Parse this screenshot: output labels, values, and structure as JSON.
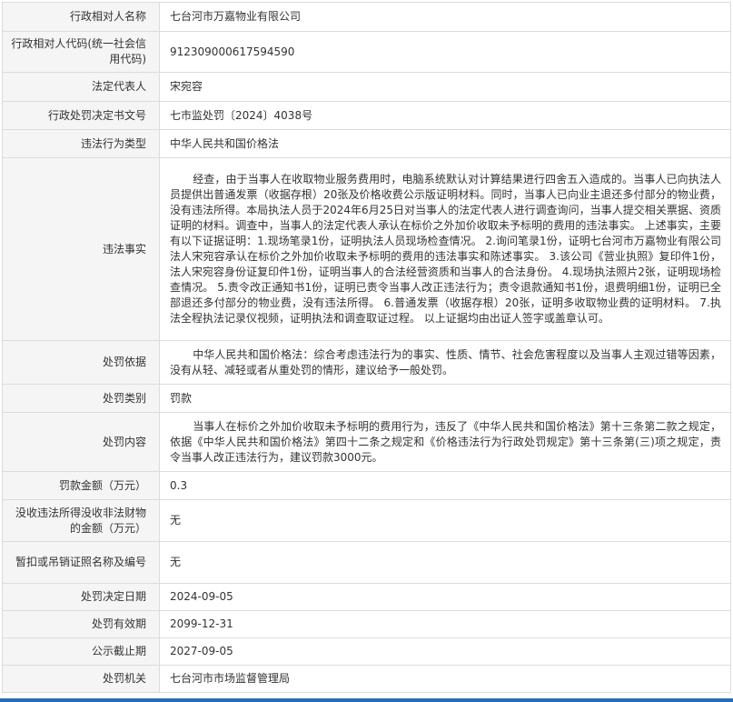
{
  "rows": [
    {
      "label": "行政相对人名称",
      "value": "七台河市万嘉物业有限公司"
    },
    {
      "label": "行政相对人代码(统一社会信用代码)",
      "value": "912309000617594590"
    },
    {
      "label": "法定代表人",
      "value": "宋宛容"
    },
    {
      "label": "行政处罚决定书文号",
      "value": "七市监处罚〔2024〕4038号"
    },
    {
      "label": "违法行为类型",
      "value": "中华人民共和国价格法"
    },
    {
      "label": "违法事实",
      "value": "经查，由于当事人在收取物业服务费用时，电脑系统默认对计算结果进行四舍五入造成的。当事人已向执法人员提供出普通发票（收据存根）20张及价格收费公示版证明材料。同时，当事人已向业主退还多付部分的物业费，没有违法所得。本局执法人员于2024年6月25日对当事人的法定代表人进行调查询问，当事人提交相关票据、资质证明的材料。调查中，当事人的法定代表人承认在标价之外加价收取未予标明的费用的违法事实。 上述事实，主要有以下证据证明：1.现场笔录1份，证明执法人员现场检查情况。 2.询问笔录1份，证明七台河市万嘉物业有限公司法人宋宛容承认在标价之外加价收取未予标明的费用的违法事实和陈述事实。 3.该公司《营业执照》复印件1份，法人宋宛容身份证复印件1份，证明当事人的合法经营资质和当事人的合法身份。 4.现场执法照片2张，证明现场检查情况。 5.责令改正通知书1份，证明已责令当事人改正违法行为；责令退款通知书1份，退费明细1份，证明已全部退还多付部分的物业费，没有违法所得。 6.普通发票（收据存根）20张，证明多收取物业费的证明材料。 7.执法全程执法记录仪视频，证明执法和调查取证过程。 以上证据均由出证人签字或盖章认可。"
    },
    {
      "label": "处罚依据",
      "value": "中华人民共和国价格法：综合考虑违法行为的事实、性质、情节、社会危害程度以及当事人主观过错等因素，没有从轻、减轻或者从重处罚的情形，建议给予一般处罚。"
    },
    {
      "label": "处罚类别",
      "value": "罚款"
    },
    {
      "label": "处罚内容",
      "value": "当事人在标价之外加价收取未予标明的费用行为，违反了《中华人民共和国价格法》第十三条第二款之规定，依据《中华人民共和国价格法》第四十二条之规定和《价格违法行为行政处罚规定》第十三条第(三)项之规定，责令当事人改正违法行为，建议罚款3000元。"
    },
    {
      "label": "罚款金额（万元）",
      "value": "0.3"
    },
    {
      "label": "没收违法所得没收非法财物的金额（万元）",
      "value": "无"
    },
    {
      "label": "暂扣或吊销证照名称及编号",
      "value": "无"
    },
    {
      "label": "处罚决定日期",
      "value": "2024-09-05"
    },
    {
      "label": "处罚有效期",
      "value": "2099-12-31"
    },
    {
      "label": "公示截止期",
      "value": "2027-09-05"
    },
    {
      "label": "处罚机关",
      "value": "七台河市市场监督管理局"
    }
  ]
}
